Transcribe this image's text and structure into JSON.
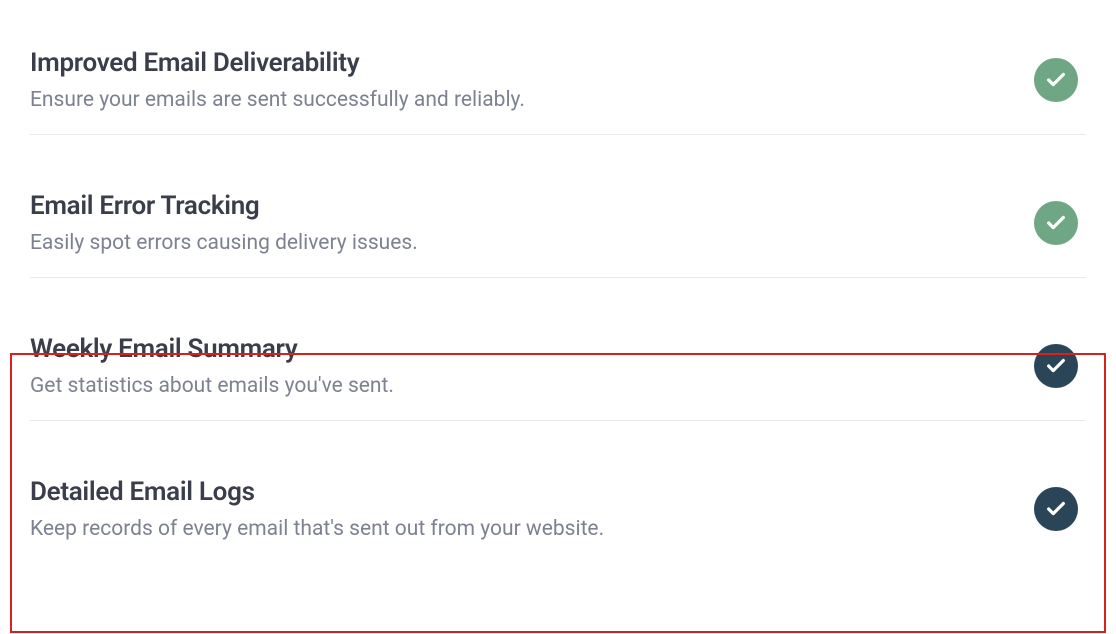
{
  "features": [
    {
      "title": "Improved Email Deliverability",
      "description": "Ensure your emails are sent successfully and reliably.",
      "badge_color": "green"
    },
    {
      "title": "Email Error Tracking",
      "description": "Easily spot errors causing delivery issues.",
      "badge_color": "green"
    },
    {
      "title": "Weekly Email Summary",
      "description": "Get statistics about emails you've sent.",
      "badge_color": "dark"
    },
    {
      "title": "Detailed Email Logs",
      "description": "Keep records of every email that's sent out from your website.",
      "badge_color": "dark"
    }
  ]
}
